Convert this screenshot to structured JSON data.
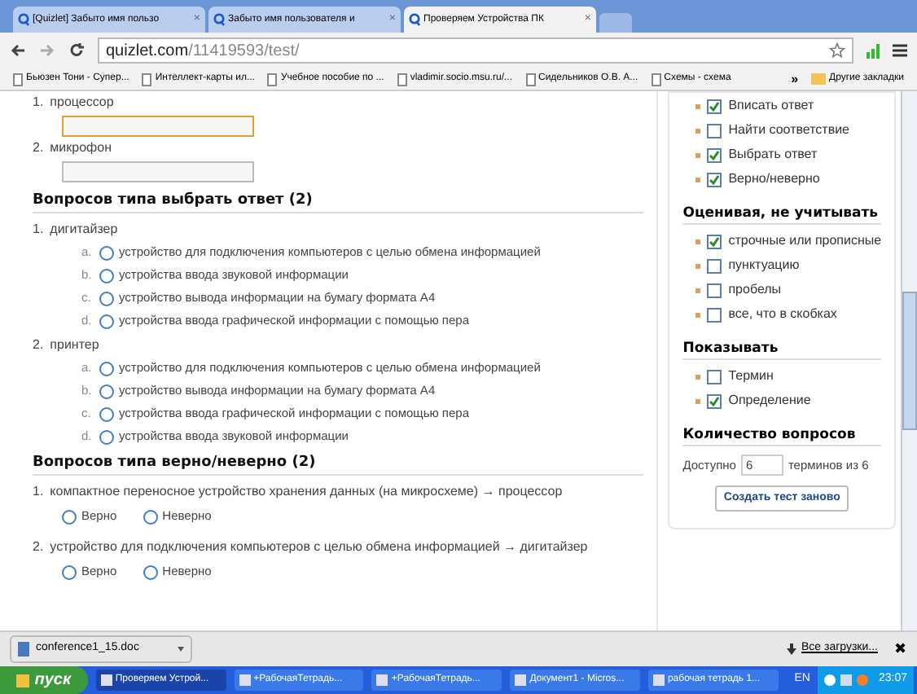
{
  "tabs": [
    {
      "label": "[Quizlet] Забыто имя пользо",
      "selected": false,
      "close": "×"
    },
    {
      "label": "Забыто имя пользователя и",
      "selected": false,
      "close": "×"
    },
    {
      "label": "Проверяем Устройства ПК",
      "selected": true,
      "close": "×"
    }
  ],
  "address": {
    "host": "quizlet.com",
    "path": "/11419593/test/"
  },
  "bookmarks": [
    {
      "label": "Бьюзен Тони - Супер..."
    },
    {
      "label": "Интеллект-карты ил..."
    },
    {
      "label": "Учебное пособие по ..."
    },
    {
      "label": "vladimir.socio.msu.ru/..."
    },
    {
      "label": "Сидельников О.В. А..."
    },
    {
      "label": "Схемы - схема"
    }
  ],
  "bookmarks_more": "»",
  "other_bookmarks": "Другие закладки",
  "written": [
    {
      "num": "1.",
      "term": "процессор",
      "focused": true
    },
    {
      "num": "2.",
      "term": "микрофон",
      "focused": false
    }
  ],
  "sections": [
    {
      "kind": "choice",
      "title": "Вопросов типа выбрать ответ (2)",
      "questions": [
        {
          "num": "1.",
          "prompt": "дигитайзер",
          "options": [
            {
              "letter": "a.",
              "text": "устройство для подключения компьютеров с целью обмена информацией",
              "selected": false
            },
            {
              "letter": "b.",
              "text": "устройства ввода звуковой информации",
              "selected": false
            },
            {
              "letter": "c.",
              "text": "устройство вывода информации на бумагу формата А4",
              "selected": false
            },
            {
              "letter": "d.",
              "text": "устройства ввода графической информации с помощью пера",
              "selected": false
            }
          ]
        },
        {
          "num": "2.",
          "prompt": "принтер",
          "options": [
            {
              "letter": "a.",
              "text": "устройство для подключения компьютеров с целью обмена информацией",
              "selected": false
            },
            {
              "letter": "b.",
              "text": "устройство вывода информации на бумагу формата А4",
              "selected": false
            },
            {
              "letter": "c.",
              "text": "устройства ввода графической информации с помощью пера",
              "selected": false
            },
            {
              "letter": "d.",
              "text": "устройства ввода звуковой информации",
              "selected": false
            }
          ]
        }
      ]
    },
    {
      "kind": "truefalse",
      "title": "Вопросов типа верно/неверно (2)",
      "questions": [
        {
          "num": "1.",
          "prompt": "компактное переносное устройство хранения данных (на микросхеме) → процессор",
          "options": [
            {
              "text": "Верно",
              "selected": false
            },
            {
              "text": "Неверно",
              "selected": false
            }
          ]
        },
        {
          "num": "2.",
          "prompt": "устройство для подключения компьютеров с целью обмена информацией → дигитайзер",
          "options": [
            {
              "text": "Верно",
              "selected": false
            },
            {
              "text": "Неверно",
              "selected": false
            }
          ]
        }
      ]
    }
  ],
  "sidebar": {
    "types": [
      {
        "label": "Вписать ответ",
        "checked": true
      },
      {
        "label": "Найти соответствие",
        "checked": false
      },
      {
        "label": "Выбрать ответ",
        "checked": true
      },
      {
        "label": "Верно/неверно",
        "checked": true
      }
    ],
    "grading_title": "Оценивая, не учитывать",
    "grading": [
      {
        "label": "строчные или прописные",
        "checked": true
      },
      {
        "label": "пунктуацию",
        "checked": false
      },
      {
        "label": "пробелы",
        "checked": false
      },
      {
        "label": "все, что в скобках",
        "checked": false
      }
    ],
    "show_title": "Показывать",
    "show": [
      {
        "label": "Термин",
        "checked": false
      },
      {
        "label": "Определение",
        "checked": true
      }
    ],
    "count_title": "Количество вопросов",
    "count_before": "Доступно",
    "count_value": "6",
    "count_after": "терминов из 6",
    "rebuild": "Создать тест заново"
  },
  "download": {
    "file": "conference1_15.doc",
    "all": "Все загрузки...",
    "close": "✖"
  },
  "taskbar": {
    "start": "пуск",
    "items": [
      {
        "label": "Проверяем Устрой...",
        "selected": true
      },
      {
        "label": "+РабочаяТетрадь...",
        "selected": false
      },
      {
        "label": "+РабочаяТетрадь...",
        "selected": false
      },
      {
        "label": "Документ1 - Micros...",
        "selected": false
      },
      {
        "label": "рабочая тетрадь 1...",
        "selected": false
      }
    ],
    "lang": "EN",
    "time": "23:07"
  }
}
